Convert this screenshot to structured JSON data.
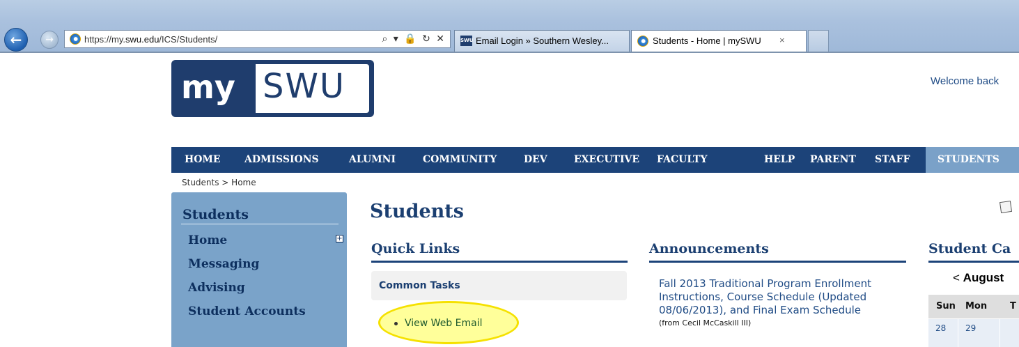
{
  "browser": {
    "address": {
      "prefix": "https://my.",
      "domain": "swu.edu",
      "path": "/ICS/Students/"
    },
    "address_icons": "⌕ ▾ 🔒 ↻ ✕",
    "tabs": [
      {
        "label": "Email Login » Southern Wesley...",
        "favicon": "SWU"
      },
      {
        "label": "Students - Home | mySWU",
        "close": "×"
      }
    ],
    "colors": {
      "chrome": "#aac1de"
    }
  },
  "logo": {
    "my": "my",
    "swu": "SWU"
  },
  "welcome": "Welcome back",
  "topnav": {
    "items": [
      "HOME",
      "ADMISSIONS",
      "ALUMNI",
      "COMMUNITY",
      "DEV",
      "EXECUTIVE",
      "FACULTY",
      "HELP",
      "PARENT",
      "STAFF",
      "STUDENTS"
    ],
    "active": "STUDENTS",
    "colors": {
      "bar": "#1c4379",
      "active": "#7aa1c8"
    }
  },
  "breadcrumb": "Students > Home",
  "sidebar": {
    "title": "Students",
    "items": [
      "Home",
      "Messaging",
      "Advising",
      "Student Accounts"
    ],
    "expand_glyph": "+"
  },
  "main": {
    "title": "Students",
    "quick_links": {
      "heading": "Quick Links",
      "group_title": "Common Tasks",
      "links": [
        "View Web Email"
      ]
    },
    "announcements": {
      "heading": "Announcements",
      "items": [
        {
          "title": "Fall 2013 Traditional Program Enrollment Instructions, Course Schedule (Updated 08/06/2013), and Final Exam Schedule",
          "from": "(from Cecil McCaskill III)"
        }
      ]
    },
    "calendar": {
      "heading": "Student Ca",
      "prev": "<",
      "month": "August",
      "days": [
        "Sun",
        "Mon",
        "T"
      ],
      "dates": [
        "28",
        "29",
        ""
      ]
    }
  }
}
